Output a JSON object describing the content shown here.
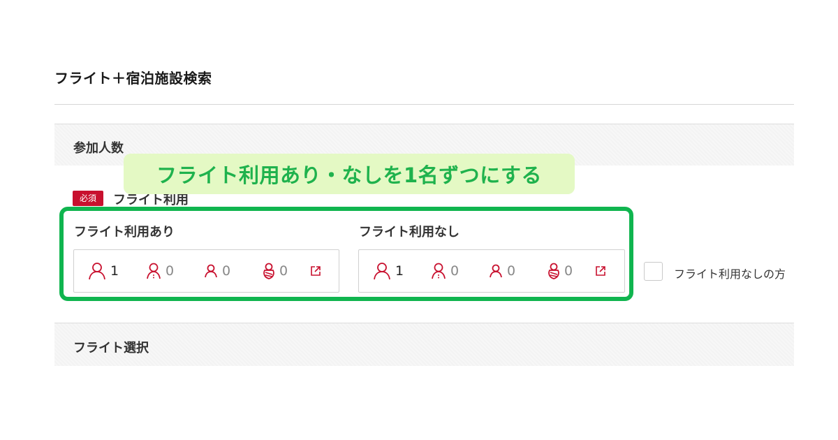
{
  "page_title": "フライト＋宿泊施設検索",
  "participants_section": {
    "title": "参加人数"
  },
  "callout_text": "フライト利用あり・なしを1名ずつにする",
  "flight_use": {
    "required_badge": "必須",
    "label": "フライト利用"
  },
  "with_flight": {
    "label": "フライト利用あり",
    "adult_count": "1",
    "child_count": "0",
    "small_child_count": "0",
    "infant_count": "0"
  },
  "without_flight": {
    "label": "フライト利用なし",
    "adult_count": "1",
    "child_count": "0",
    "small_child_count": "0",
    "infant_count": "0"
  },
  "checkbox_label": "フライト利用なしの方",
  "flight_section": {
    "title": "フライト選択"
  },
  "colors": {
    "accent_red": "#c8102e",
    "highlight_green": "#10b54f",
    "callout_bg": "#e4f9c4",
    "callout_text": "#1fb24d"
  },
  "icons": [
    "adult-icon",
    "child-icon",
    "small-child-icon",
    "infant-icon",
    "external-link-icon"
  ]
}
